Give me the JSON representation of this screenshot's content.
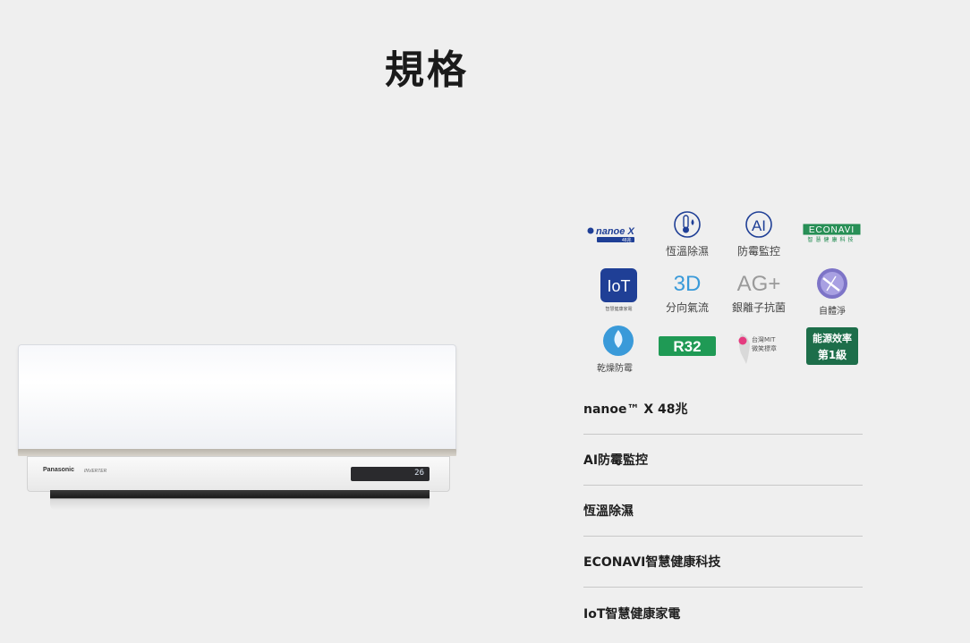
{
  "page": {
    "title": "規格"
  },
  "product": {
    "brand": "Panasonic",
    "series": "INVERTER",
    "display_reading": "26"
  },
  "features": {
    "nanoe": {
      "logo_text": "nanoe X",
      "badge": "48兆"
    },
    "humidity": {
      "label": "恆溫除濕",
      "icon": "thermometer-droplet-icon"
    },
    "ai": {
      "label": "防霉監控",
      "icon_text": "AI"
    },
    "econavi": {
      "logo_text": "ECONAVI",
      "sub": "智慧健康科技"
    },
    "iot": {
      "icon_text": "IoT",
      "sub": "智慧健康家電"
    },
    "airflow": {
      "icon_text": "3D",
      "label": "分向氣流"
    },
    "ag": {
      "icon_text": "AG+",
      "label": "銀離子抗菌"
    },
    "self_clean": {
      "label": "自體淨",
      "icon": "self-clean-icon"
    },
    "dry": {
      "label": "乾燥防霉",
      "icon": "water-drop-icon"
    },
    "refrigerant": {
      "icon_text": "R32"
    },
    "mit": {
      "line1": "台灣MIT",
      "line2": "微笑標章"
    },
    "energy": {
      "line1": "能源效率",
      "line2": "第1級"
    }
  },
  "specs": [
    "nanoe™ X 48兆",
    "AI防霉監控",
    "恆溫除濕",
    "ECONAVI智慧健康科技",
    "IoT智慧健康家電"
  ],
  "colors": {
    "background": "#efefef",
    "nanoe_blue": "#1f3f96",
    "econavi_green": "#1d8a4e",
    "r32_green": "#1f9a55",
    "energy_green": "#1d6e4a",
    "airflow_blue": "#3a9ad9"
  }
}
